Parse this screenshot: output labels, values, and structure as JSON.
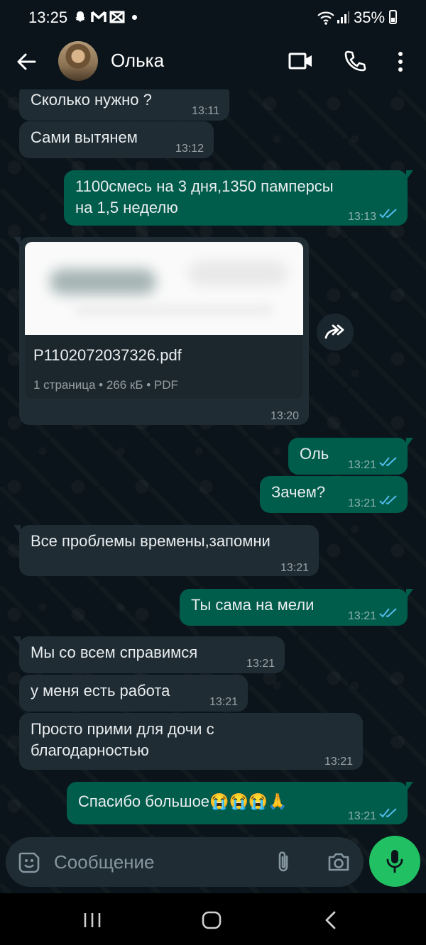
{
  "status_bar": {
    "time": "13:25",
    "battery": "35%"
  },
  "header": {
    "contact_name": "Олька"
  },
  "messages": [
    {
      "text": "Сколько нужно ?",
      "time": "13:11"
    },
    {
      "text": "Сами вытянем",
      "time": "13:12"
    },
    {
      "text_line1": "1100смесь на 3 дня,1350 памперсы",
      "text_line2": "на 1,5 неделю",
      "time": "13:13"
    },
    {
      "file_name": "P1102072037326.pdf",
      "file_meta": "1 страница • 266 кБ • PDF",
      "time": "13:20"
    },
    {
      "text": "Оль",
      "time": "13:21"
    },
    {
      "text": "Зачем?",
      "time": "13:21"
    },
    {
      "text": "Все проблемы времены,запомни",
      "time": "13:21"
    },
    {
      "text": "Ты сама на мели",
      "time": "13:21"
    },
    {
      "text": "Мы со всем справимся",
      "time": "13:21"
    },
    {
      "text": "у меня есть работа",
      "time": "13:21"
    },
    {
      "text_line1": "Просто прими для дочи с",
      "text_line2": "благодарностью",
      "time": "13:21"
    },
    {
      "text": "Спасибо большое😭😭😭🙏",
      "time": "13:21"
    }
  ],
  "composer": {
    "placeholder": "Сообщение"
  },
  "colors": {
    "incoming": "#1f2c34",
    "outgoing": "#005c4b",
    "accent": "#21c063",
    "read_ticks": "#53bdeb"
  }
}
